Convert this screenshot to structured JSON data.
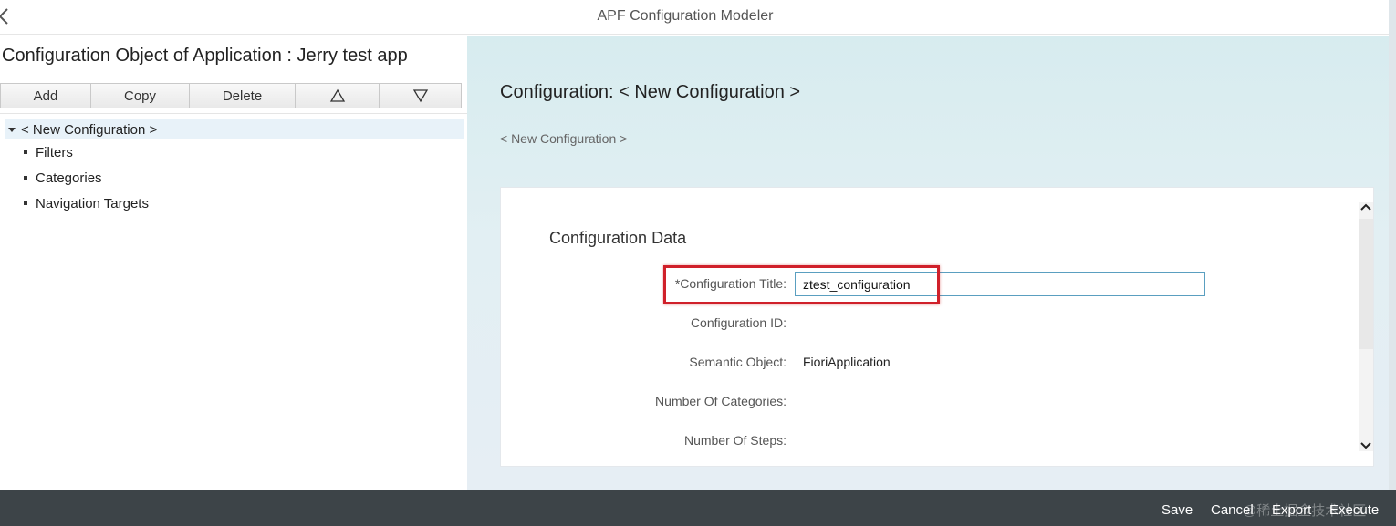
{
  "shell": {
    "title": "APF Configuration Modeler",
    "back_icon": "chevron-left-icon"
  },
  "left": {
    "heading": "Configuration Object of Application : Jerry test app",
    "toolbar": {
      "add": "Add",
      "copy": "Copy",
      "delete": "Delete",
      "move_up_icon": "triangle-up-icon",
      "move_down_icon": "triangle-down-icon"
    },
    "tree": {
      "root": "< New Configuration >",
      "children": [
        "Filters",
        "Categories",
        "Navigation Targets"
      ]
    }
  },
  "main": {
    "heading": "Configuration: < New Configuration >",
    "breadcrumb": "< New Configuration >",
    "section_title": "Configuration Data",
    "fields": {
      "title_label": "*Configuration Title:",
      "title_value": "ztest_configuration",
      "id_label": "Configuration ID:",
      "id_value": "",
      "semantic_label": "Semantic Object:",
      "semantic_value": "FioriApplication",
      "categories_label": "Number Of Categories:",
      "categories_value": "",
      "steps_label": "Number Of Steps:",
      "steps_value": ""
    },
    "highlight_color": "#d0202a"
  },
  "footer": {
    "save": "Save",
    "cancel": "Cancel",
    "export": "Export",
    "execute": "Execute",
    "watermark": "@稀土掘金技术社区"
  },
  "colors": {
    "footer_bg": "#3d4448",
    "input_border": "#5a9fc0",
    "tree_selected_bg": "#e8f2f9"
  }
}
